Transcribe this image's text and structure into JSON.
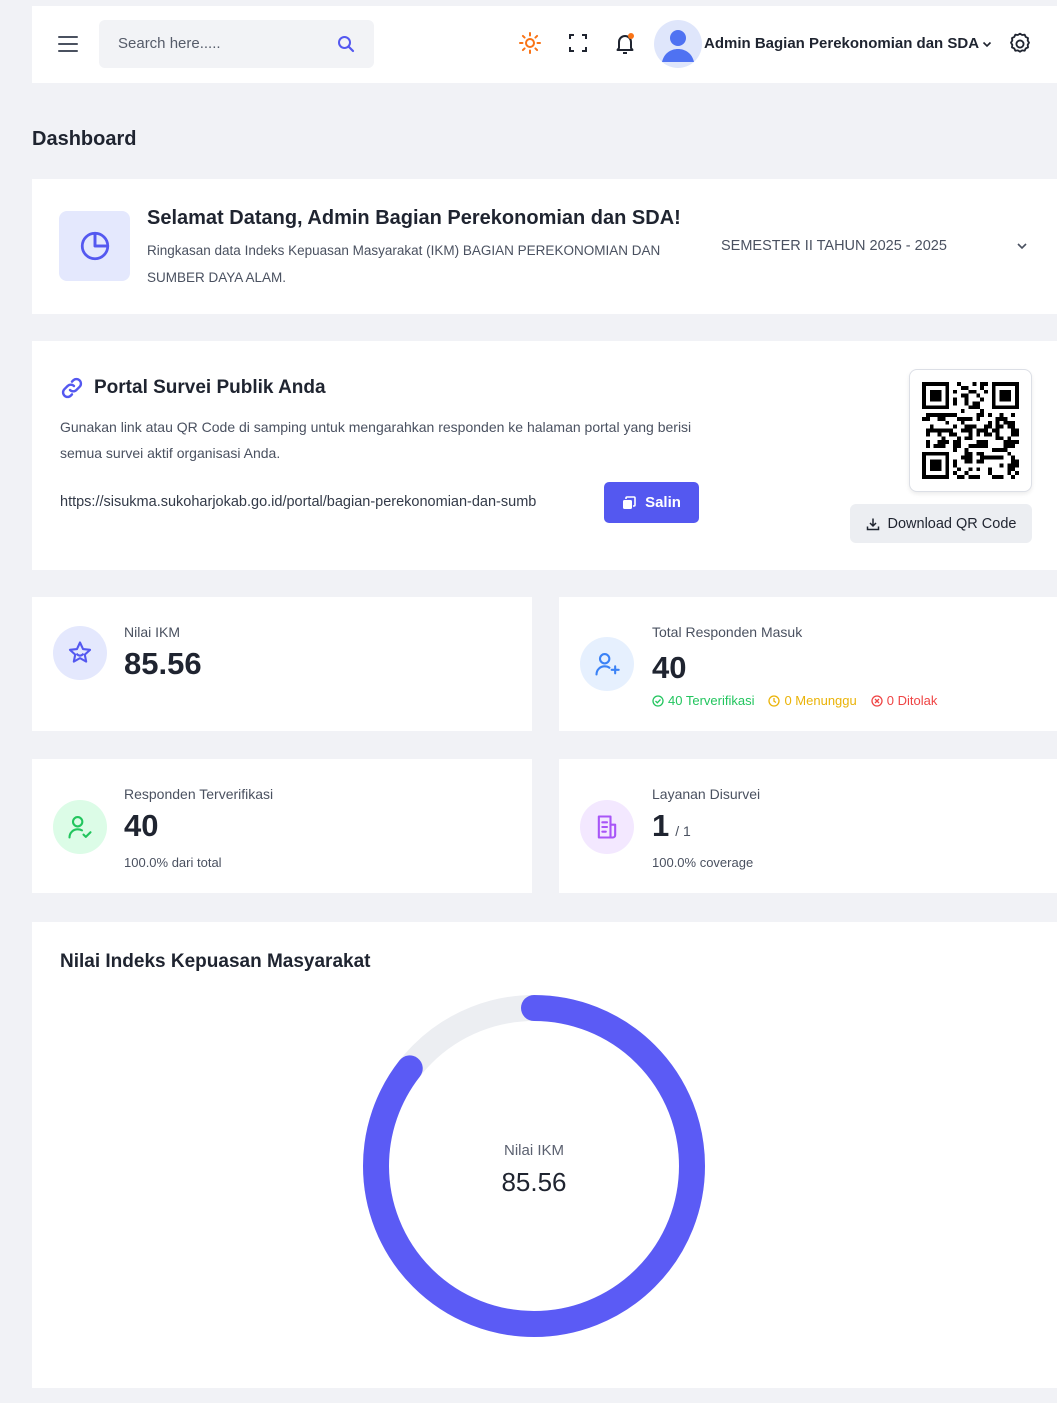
{
  "header": {
    "search_placeholder": "Search here.....",
    "user_name": "Admin Bagian Perekonomian dan SDA"
  },
  "page": {
    "title": "Dashboard"
  },
  "welcome": {
    "title": "Selamat Datang, Admin Bagian Perekonomian dan SDA!",
    "description": "Ringkasan data Indeks Kepuasan Masyarakat (IKM) BAGIAN PEREKONOMIAN DAN SUMBER DAYA ALAM.",
    "semester": "SEMESTER II TAHUN 2025 - 2025"
  },
  "portal": {
    "title": "Portal Survei Publik Anda",
    "description": "Gunakan link atau QR Code di samping untuk mengarahkan responden ke halaman portal yang berisi semua survei aktif organisasi Anda.",
    "link": "https://sisukma.sukoharjokab.go.id/portal/bagian-perekonomian-dan-sumb",
    "copy_label": "Salin",
    "download_label": "Download QR Code"
  },
  "stats": {
    "ikm": {
      "label": "Nilai IKM",
      "value": "85.56"
    },
    "respondents": {
      "label": "Total Responden Masuk",
      "value": "40",
      "verified": "40 Terverifikasi",
      "pending": "0 Menunggu",
      "rejected": "0 Ditolak"
    },
    "verified": {
      "label": "Responden Terverifikasi",
      "value": "40",
      "sub": "100.0% dari total"
    },
    "services": {
      "label": "Layanan Disurvei",
      "value": "1",
      "total": "/ 1",
      "sub": "100.0% coverage"
    }
  },
  "colors": {
    "accent": "#5b5bf5",
    "track": "#eceef2",
    "verified": "#22c55e",
    "pending": "#eab308",
    "rejected": "#ef4444"
  },
  "chart_data": {
    "type": "donut",
    "title": "Nilai Indeks Kepuasan Masyarakat",
    "center_label": "Nilai IKM",
    "center_value": "85.56",
    "value": 85.56,
    "max": 100
  }
}
